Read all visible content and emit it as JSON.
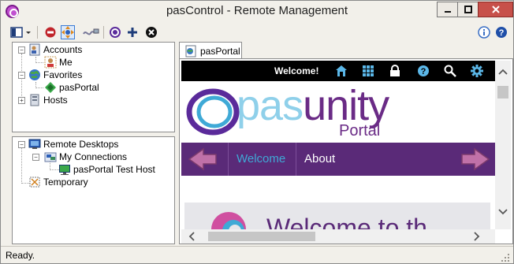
{
  "window": {
    "title": "pasControl - Remote Management"
  },
  "tree_top": {
    "accounts": "Accounts",
    "me": "Me",
    "favorites": "Favorites",
    "pasportal": "pasPortal",
    "hosts": "Hosts"
  },
  "tree_bottom": {
    "remote_desktops": "Remote Desktops",
    "my_connections": "My Connections",
    "test_host": "pasPortal Test Host",
    "temporary": "Temporary"
  },
  "tab": {
    "label": "pasPortal"
  },
  "web": {
    "welcome": "Welcome!",
    "logo_pas": "pas",
    "logo_unity": "unity",
    "logo_portal": "Portal",
    "nav_welcome": "Welcome",
    "nav_about": "About",
    "hero_text": "Welcome to th"
  },
  "status": {
    "text": "Ready."
  },
  "colors": {
    "nav_bg": "#5a2a78",
    "accent_teal": "#3fa9d6",
    "logo_purple": "#6a2b86",
    "close_red": "#c7504a"
  }
}
